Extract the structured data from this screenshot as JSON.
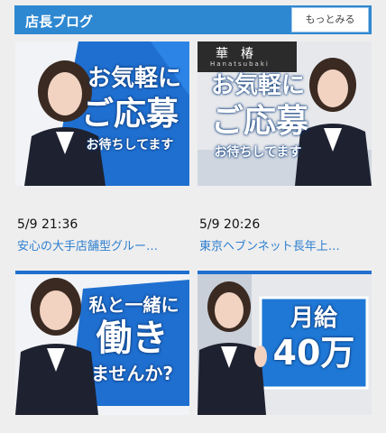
{
  "header": {
    "title": "店長ブログ",
    "more_label": "もっとみる"
  },
  "posts": [
    {
      "date": "5/9 21:36",
      "title": "安心の大手店舗型グルー…",
      "banner_line1": "お気軽に",
      "banner_line2": "ご応募",
      "banner_line3": "お待ちしてます"
    },
    {
      "date": "5/9 20:26",
      "title": "東京ヘブンネット長年上…",
      "banner_line1": "お気軽に",
      "banner_line2": "ご応募",
      "banner_line3": "お待ちしてます",
      "sign_text": "華　椿",
      "sign_sub": "Hanatsubaki"
    },
    {
      "banner_line1": "私と一緒に",
      "banner_line2": "働き",
      "banner_line3": "ませんか?"
    },
    {
      "banner_line1": "月給",
      "banner_line2": "40万"
    }
  ],
  "colors": {
    "header": "#2e88d1",
    "link": "#2e7fcf",
    "banner_blue": "#1f6fd0"
  }
}
